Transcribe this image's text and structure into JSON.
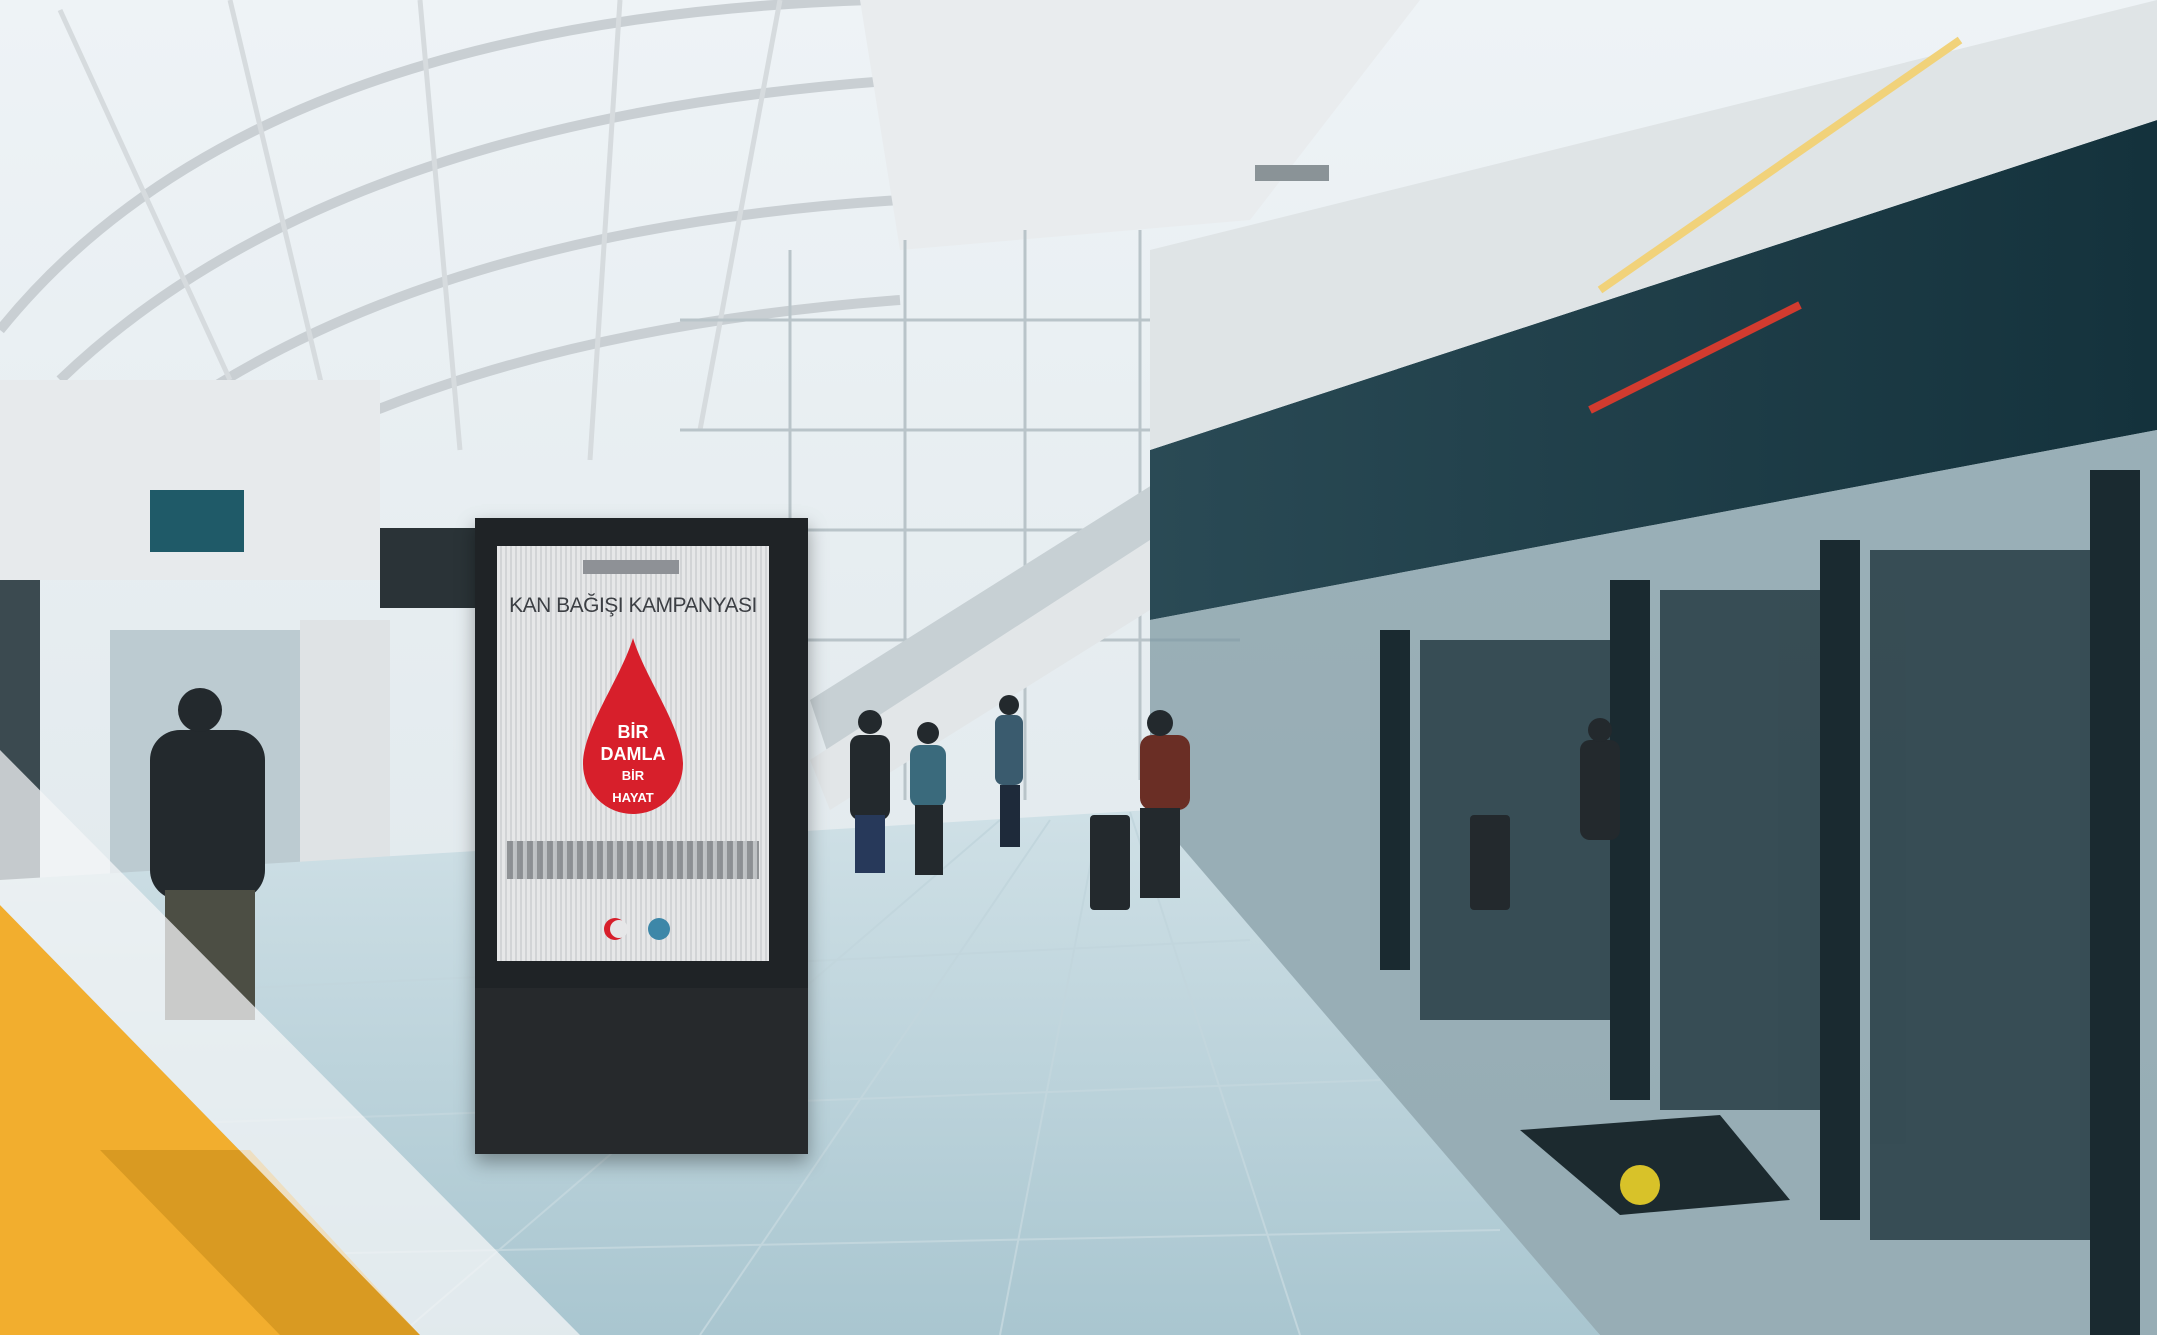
{
  "ad": {
    "campaign_title": "KAN BAĞIŞI KAMPANYASI",
    "slogan_line1": "BİR",
    "slogan_line2": "DAMLA",
    "slogan_line3": "BİR",
    "slogan_line4": "HAYAT"
  },
  "colors": {
    "accent_yellow": "#f2ae2e",
    "blood_red": "#d71f2b",
    "metro_wall": "#1f3f4a"
  },
  "icons": {
    "drop": "blood-drop-icon",
    "logo1": "red-crescent-logo-icon",
    "logo2": "ministry-logo-icon"
  }
}
